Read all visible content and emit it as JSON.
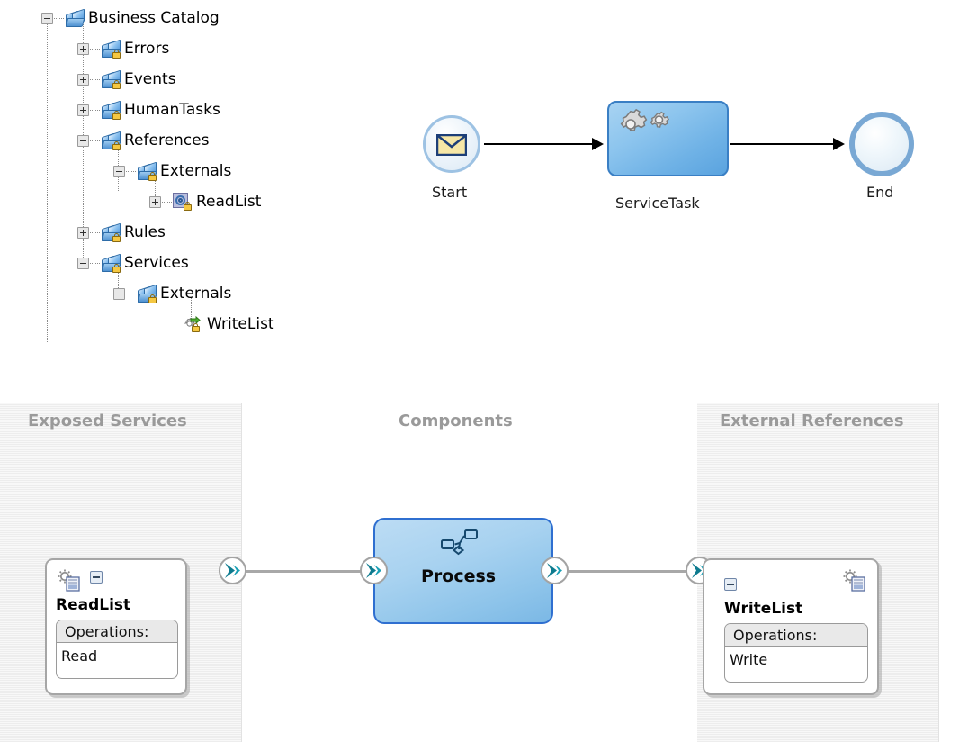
{
  "tree": {
    "name": "business-catalog-tree",
    "nodes": [
      {
        "label": "Business Catalog",
        "icon": "catalog-folder-icon",
        "toggle": "minus",
        "depth": 0,
        "locked": false
      },
      {
        "label": "Errors",
        "icon": "locked-folder-icon",
        "toggle": "plus",
        "depth": 1,
        "locked": true
      },
      {
        "label": "Events",
        "icon": "locked-folder-icon",
        "toggle": "plus",
        "depth": 1,
        "locked": true
      },
      {
        "label": "HumanTasks",
        "icon": "locked-folder-icon",
        "toggle": "plus",
        "depth": 1,
        "locked": true
      },
      {
        "label": "References",
        "icon": "locked-folder-icon",
        "toggle": "minus",
        "depth": 1,
        "locked": true
      },
      {
        "label": "Externals",
        "icon": "locked-folder-icon",
        "toggle": "minus",
        "depth": 2,
        "locked": true
      },
      {
        "label": "ReadList",
        "icon": "readlist-service-icon",
        "toggle": "plus",
        "depth": 3,
        "locked": true
      },
      {
        "label": "Rules",
        "icon": "locked-folder-icon",
        "toggle": "plus",
        "depth": 1,
        "locked": true
      },
      {
        "label": "Services",
        "icon": "locked-folder-icon",
        "toggle": "minus",
        "depth": 1,
        "locked": true
      },
      {
        "label": "Externals",
        "icon": "locked-folder-icon",
        "toggle": "minus",
        "depth": 2,
        "locked": true
      },
      {
        "label": "WriteList",
        "icon": "writelist-service-icon",
        "toggle": "none",
        "depth": 3,
        "locked": true
      }
    ]
  },
  "bpmn": {
    "name": "bpmn-process-diagram",
    "start": {
      "label": "Start",
      "icon": "message-start-event-icon"
    },
    "task": {
      "label": "ServiceTask",
      "icon": "service-task-gears-icon"
    },
    "end": {
      "label": "End",
      "icon": "end-event-icon"
    },
    "flows": [
      {
        "from": "Start",
        "to": "ServiceTask"
      },
      {
        "from": "ServiceTask",
        "to": "End"
      }
    ]
  },
  "sca": {
    "name": "sca-composite-editor",
    "panels": {
      "exposed_services": "Exposed Services",
      "components": "Components",
      "external_references": "External References"
    },
    "service": {
      "title": "ReadList",
      "icon": "web-service-icon",
      "collapse_icon": "minus-toggle-icon",
      "operations_header": "Operations:",
      "operations": [
        "Read"
      ],
      "port_icon": "service-port-chevron-icon"
    },
    "component": {
      "title": "Process",
      "icon": "bpmn-component-icon",
      "left_port_icon": "service-port-chevron-icon",
      "right_port_icon": "reference-port-chevron-icon"
    },
    "reference": {
      "title": "WriteList",
      "icon": "web-service-icon",
      "collapse_icon": "minus-toggle-icon",
      "operations_header": "Operations:",
      "operations": [
        "Write"
      ],
      "port_icon": "reference-port-chevron-icon"
    }
  },
  "colors": {
    "panel_bg": "#f2f2f2",
    "panel_title": "#9a9a9a",
    "component_fill": "#a8d2f0",
    "component_border": "#2f6fd0",
    "task_border": "#3a7fc4",
    "wire": "#a8a8a8",
    "port_chevron": "#0d7b8f",
    "start_border": "#9dc2e3",
    "end_border": "#79a8d4"
  }
}
